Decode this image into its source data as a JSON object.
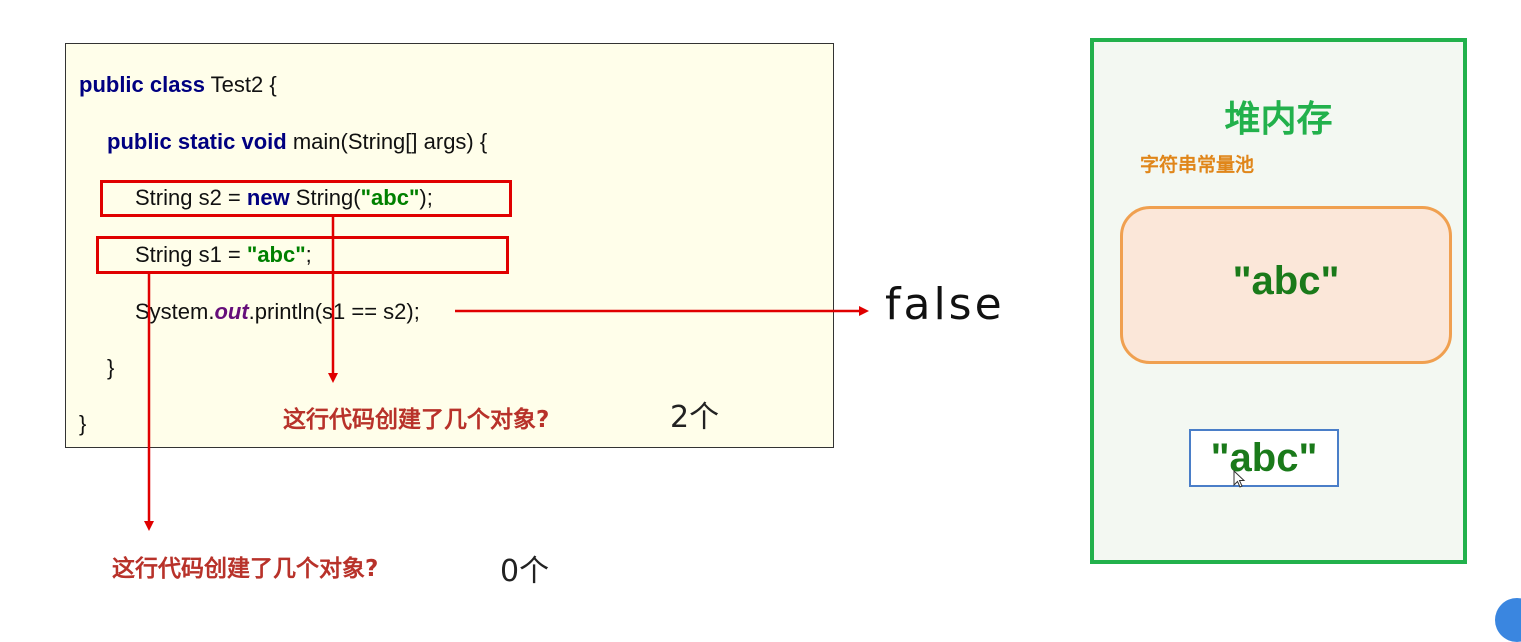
{
  "code": {
    "line1": {
      "kw": "public class",
      "rest": " Test2 {"
    },
    "line2": {
      "kw": "public static void",
      "rest": " main(String[] args) {"
    },
    "line3": {
      "pre": "String s2 = ",
      "kw": "new",
      "mid": " String(",
      "str": "\"abc\"",
      "post": ");"
    },
    "line4": {
      "pre": "String s1 = ",
      "str": "\"abc\"",
      "post": ";"
    },
    "line5": {
      "pre": "System.",
      "fld": "out",
      "post": ".println(s1 == s2);"
    },
    "line6": "}",
    "line7": "}"
  },
  "annotations": {
    "question_new": "这行代码创建了几个对象?",
    "answer_new": "2个",
    "question_literal": "这行代码创建了几个对象?",
    "answer_literal": "0个",
    "result": "false"
  },
  "heap": {
    "title": "堆内存",
    "pool_label": "字符串常量池",
    "pool_string": "\"abc\"",
    "heap_object_string": "\"abc\""
  },
  "colors": {
    "arrow": "#e00000",
    "heap_border": "#22b14c",
    "pool_border": "#f0a050",
    "heap_object_border": "#4a7ec8",
    "keyword": "#000080",
    "string": "#008000",
    "question": "#b8322a"
  }
}
